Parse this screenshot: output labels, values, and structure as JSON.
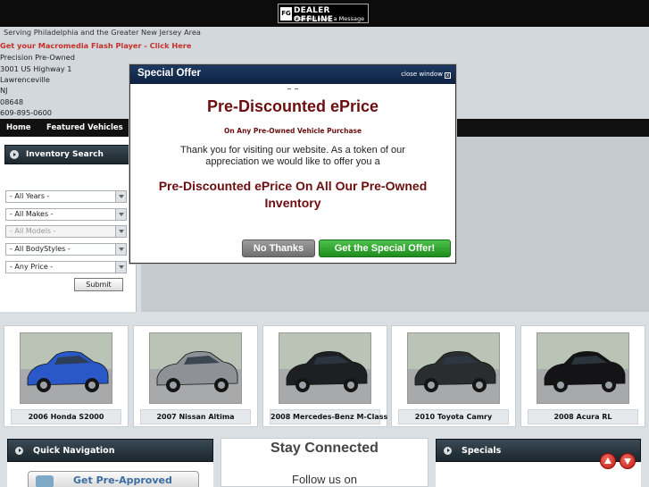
{
  "dealer_badge": {
    "logo": "FG",
    "line1": "DEALER OFFLINE",
    "line2": "Please Leave a Message"
  },
  "info": {
    "tagline": "Serving Philadelphia and the Greater New Jersey Area",
    "flash_link": "Get your Macromedia Flash Player - Click Here",
    "dealer_name": "Precision Pre-Owned",
    "address": "3001 US Highway 1",
    "city": "Lawrenceville",
    "state": "NJ",
    "zip": "08648",
    "phone": "609-895-0600"
  },
  "nav": {
    "home": "Home",
    "featured": "Featured Vehicles"
  },
  "search": {
    "title": "Inventory Search",
    "years": "- All Years -",
    "makes": "- All Makes -",
    "models": "- All Models -",
    "bodystyles": "- All BodyStyles -",
    "price": "- Any Price -",
    "submit": "Submit"
  },
  "vehicles": [
    {
      "name": "2006 Honda S2000",
      "color": "#2b58c8"
    },
    {
      "name": "2007 Nissan Altima",
      "color": "#8e9296"
    },
    {
      "name": "2008 Mercedes-Benz M-Class",
      "color": "#1e1f22"
    },
    {
      "name": "2010 Toyota Camry",
      "color": "#2a2c2e"
    },
    {
      "name": "2008 Acura RL",
      "color": "#141416"
    }
  ],
  "quick_nav": {
    "title": "Quick Navigation",
    "preapproved": "Get Pre-Approved"
  },
  "stay_connected": {
    "title": "Stay Connected",
    "follow": "Follow us on"
  },
  "specials": {
    "title": "Specials"
  },
  "modal": {
    "title": "Special Offer",
    "close": "close window",
    "close_icon": "x",
    "dashes": "– –",
    "headline": "Pre-Discounted ePrice",
    "subheadline": "On Any Pre-Owned Vehicle Purchase",
    "message": "Thank you for visiting our website. As a token of our appreciation we would like to offer you a",
    "offer": "Pre-Discounted ePrice On All Our Pre-Owned Inventory",
    "no_thanks": "No Thanks",
    "get_offer": "Get the Special Offer!"
  }
}
